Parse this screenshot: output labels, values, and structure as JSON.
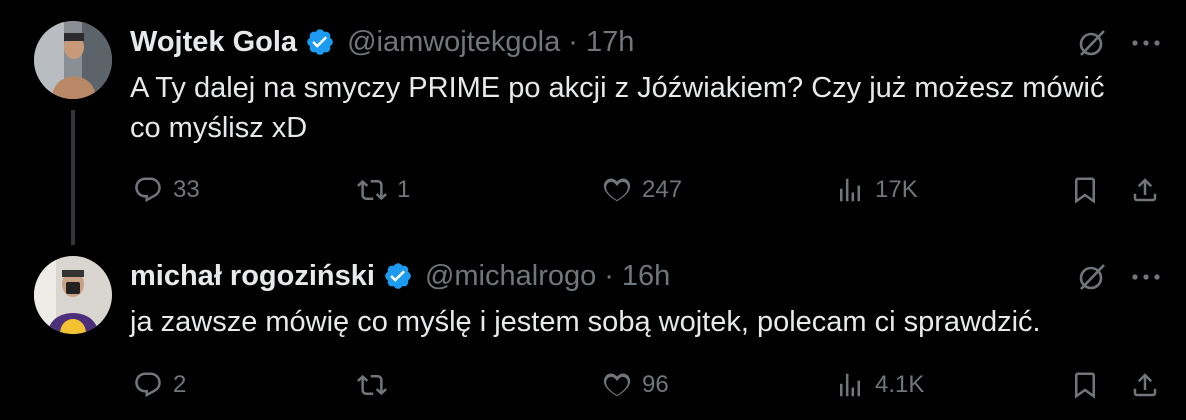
{
  "colors": {
    "background": "#000000",
    "text": "#e7e9ea",
    "muted": "#71767b",
    "verified": "#1d9bf0",
    "thread_line": "#333639"
  },
  "tweets": [
    {
      "name": "Wojtek Gola",
      "handle": "@iamwojtekgola",
      "separator": "·",
      "time": "17h",
      "text": "A Ty dalej na smyczy PRIME po akcji z Jóźwiakiem? Czy już możesz mówić co myślisz xD",
      "replies": "33",
      "reposts": "1",
      "likes": "247",
      "views": "17K"
    },
    {
      "name": "michał rogoziński",
      "handle": "@michalrogo",
      "separator": "·",
      "time": "16h",
      "text": "ja zawsze mówię co myślę i jestem sobą wojtek, polecam ci sprawdzić.",
      "replies": "2",
      "reposts": "",
      "likes": "96",
      "views": "4.1K"
    }
  ],
  "icons": [
    "verified-badge-icon",
    "grok-icon",
    "more-icon",
    "reply-icon",
    "repost-icon",
    "like-icon",
    "views-icon",
    "bookmark-icon",
    "share-icon"
  ]
}
